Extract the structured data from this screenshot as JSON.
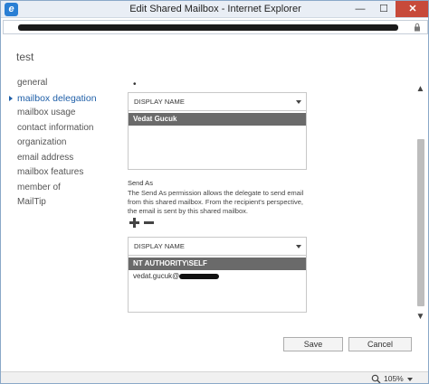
{
  "window": {
    "title": "Edit Shared Mailbox - Internet Explorer",
    "min_label": "—",
    "max_label": "☐",
    "close_label": "✕"
  },
  "page": {
    "title": "test"
  },
  "nav": {
    "items": [
      {
        "label": "general",
        "active": false
      },
      {
        "label": "mailbox delegation",
        "active": true
      },
      {
        "label": "mailbox usage",
        "active": false
      },
      {
        "label": "contact information",
        "active": false
      },
      {
        "label": "organization",
        "active": false
      },
      {
        "label": "email address",
        "active": false
      },
      {
        "label": "mailbox features",
        "active": false
      },
      {
        "label": "member of",
        "active": false
      },
      {
        "label": "MailTip",
        "active": false
      }
    ]
  },
  "full_access": {
    "bullet": "•",
    "column_header": "DISPLAY NAME",
    "rows": [
      "Vedat Gucuk"
    ]
  },
  "send_as": {
    "label": "Send As",
    "description": "The Send As permission allows the delegate to send email from this shared mailbox. From the recipient's perspective, the email is sent by this shared mailbox.",
    "column_header": "DISPLAY NAME",
    "rows": [
      "NT AUTHORITY\\SELF",
      "vedat.gucuk@"
    ]
  },
  "buttons": {
    "save": "Save",
    "cancel": "Cancel"
  },
  "scrollbar": {
    "up": "▲",
    "down": "▼"
  },
  "status": {
    "zoom": "105%"
  },
  "colors": {
    "accent": "#1f5fa8",
    "selected_row": "#6a6a6a",
    "close_button": "#c74a3a"
  }
}
